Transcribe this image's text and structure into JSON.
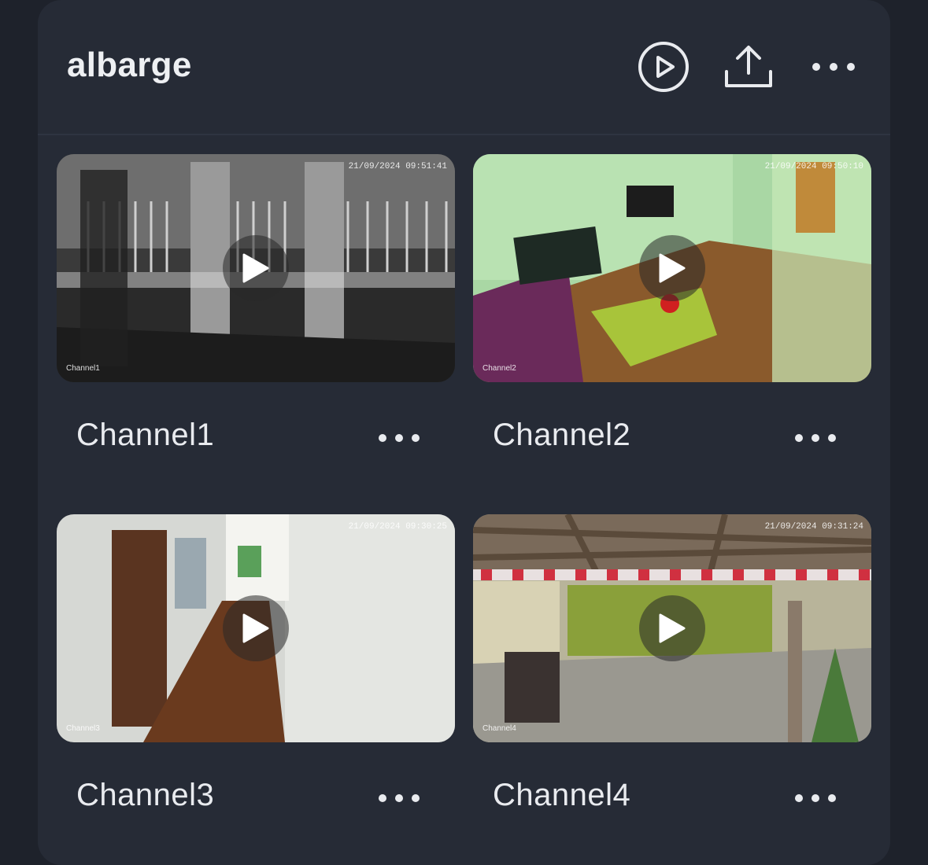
{
  "header": {
    "title": "albarge",
    "icons": [
      "play-circle-icon",
      "upload-icon",
      "more-icon"
    ]
  },
  "channels": [
    {
      "name": "Channel1",
      "overlay_label": "Channel1",
      "timestamp": "21/09/2024 09:51:41"
    },
    {
      "name": "Channel2",
      "overlay_label": "Channel2",
      "timestamp": "21/09/2024 09:50:10"
    },
    {
      "name": "Channel3",
      "overlay_label": "Channel3",
      "timestamp": "21/09/2024 09:30:25"
    },
    {
      "name": "Channel4",
      "overlay_label": "Channel4",
      "timestamp": "21/09/2024 09:31:24"
    }
  ],
  "colors": {
    "background": "#1e222b",
    "card": "#262b36",
    "text": "#e9ebef"
  }
}
